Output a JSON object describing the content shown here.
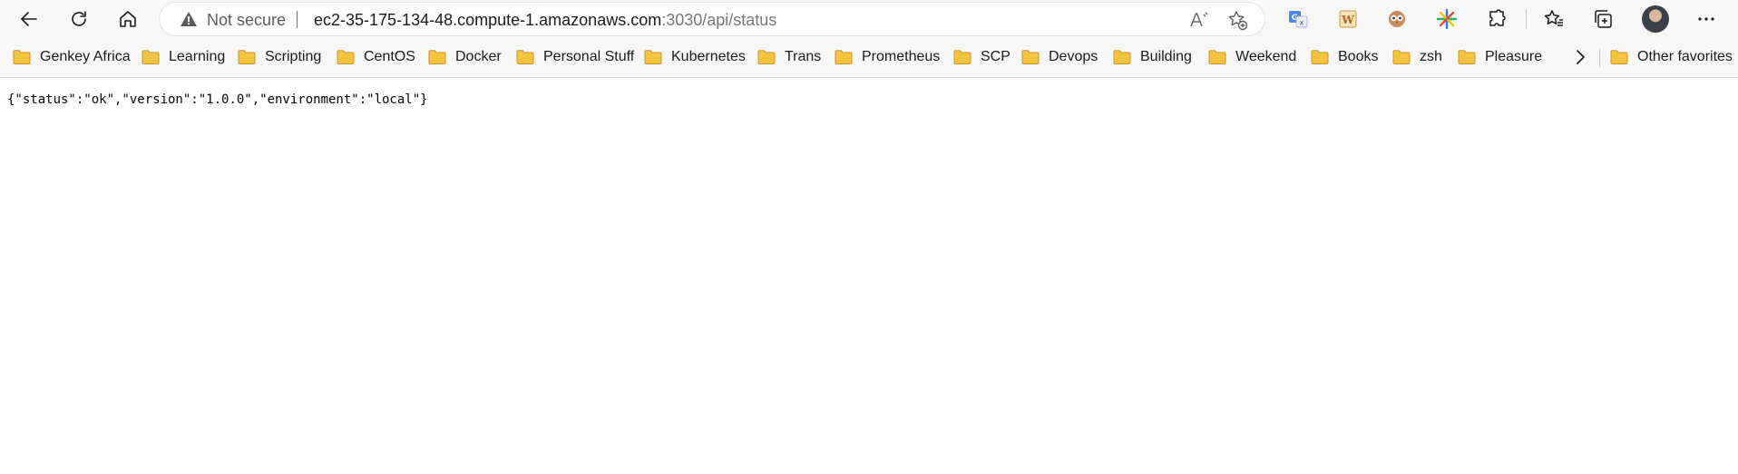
{
  "browser": {
    "security_label": "Not secure",
    "url_host": "ec2-35-175-134-48.compute-1.amazonaws.com",
    "url_rest": ":3030/api/status",
    "icons": [
      "back-icon",
      "refresh-icon",
      "home-icon",
      "warning-icon",
      "read-aloud-icon",
      "add-favorite-icon",
      "translate-extension-icon",
      "w-extension-icon",
      "owl-extension-icon",
      "sparkle-extension-icon",
      "extensions-icon",
      "favorites-icon",
      "collections-icon",
      "profile-avatar",
      "more-icon"
    ]
  },
  "favorites": [
    "Genkey Africa",
    "Learning",
    "Scripting",
    "CentOS",
    "Docker",
    "Personal Stuff",
    "Kubernetes",
    "Trans",
    "Prometheus",
    "SCP",
    "Devops",
    "Building",
    "Weekend",
    "Books",
    "zsh",
    "Pleasure"
  ],
  "other_favorites": "Other favorites",
  "page": {
    "body": "{\"status\":\"ok\",\"version\":\"1.0.0\",\"environment\":\"local\"}"
  },
  "colors": {
    "toolbar_bg": "#f7f7f7",
    "folder": "#f5c542",
    "folder_outline": "#c9952b"
  }
}
